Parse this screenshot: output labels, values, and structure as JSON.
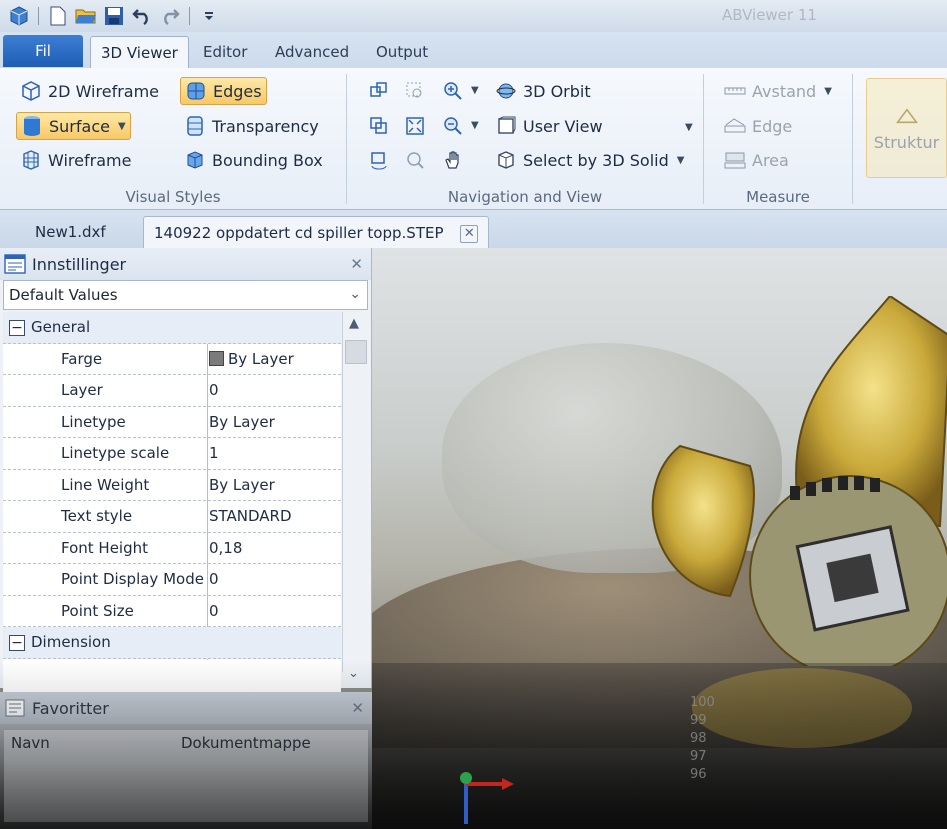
{
  "app": {
    "title": "ABViewer 11"
  },
  "colors": {
    "accent": "#1f5db5",
    "highlight": "#f8c865",
    "ribbon": "#e7eef7",
    "gold": "#c9a93a"
  },
  "tabs": [
    {
      "label": "Fil"
    },
    {
      "label": "3D Viewer"
    },
    {
      "label": "Editor"
    },
    {
      "label": "Advanced"
    },
    {
      "label": "Output"
    }
  ],
  "ribbon": {
    "visual_styles": {
      "caption": "Visual Styles",
      "wireframe2d": "2D Wireframe",
      "edges": "Edges",
      "surface": "Surface",
      "transparency": "Transparency",
      "wireframe": "Wireframe",
      "bounding_box": "Bounding Box"
    },
    "navigation": {
      "caption": "Navigation and View",
      "orbit": "3D Orbit",
      "user_view": "User View",
      "select_solid": "Select by 3D Solid"
    },
    "measure": {
      "caption": "Measure",
      "distance": "Avstand",
      "edge": "Edge",
      "area": "Area"
    },
    "extra": {
      "structure": "Struktur"
    }
  },
  "documents": [
    {
      "name": "New1.dxf"
    },
    {
      "name": "140922 oppdatert cd spiller topp.STEP"
    }
  ],
  "properties": {
    "title": "Innstillinger",
    "preset": "Default Values",
    "categories": {
      "general": "General",
      "dimension": "Dimension"
    },
    "rows": [
      {
        "label": "Farge",
        "value": "By Layer"
      },
      {
        "label": "Layer",
        "value": "0"
      },
      {
        "label": "Linetype",
        "value": "By Layer"
      },
      {
        "label": "Linetype scale",
        "value": "1"
      },
      {
        "label": "Line Weight",
        "value": "By Layer"
      },
      {
        "label": "Text style",
        "value": "STANDARD"
      },
      {
        "label": "Font Height",
        "value": "0,18"
      },
      {
        "label": "Point Display Mode",
        "value": "0"
      },
      {
        "label": "Point Size",
        "value": "0"
      }
    ]
  },
  "favorites": {
    "title": "Favoritter",
    "col_name": "Navn",
    "col_folder": "Dokumentmappe"
  },
  "ruler": {
    "ticks": [
      "100",
      "99",
      "98",
      "97",
      "96"
    ]
  }
}
